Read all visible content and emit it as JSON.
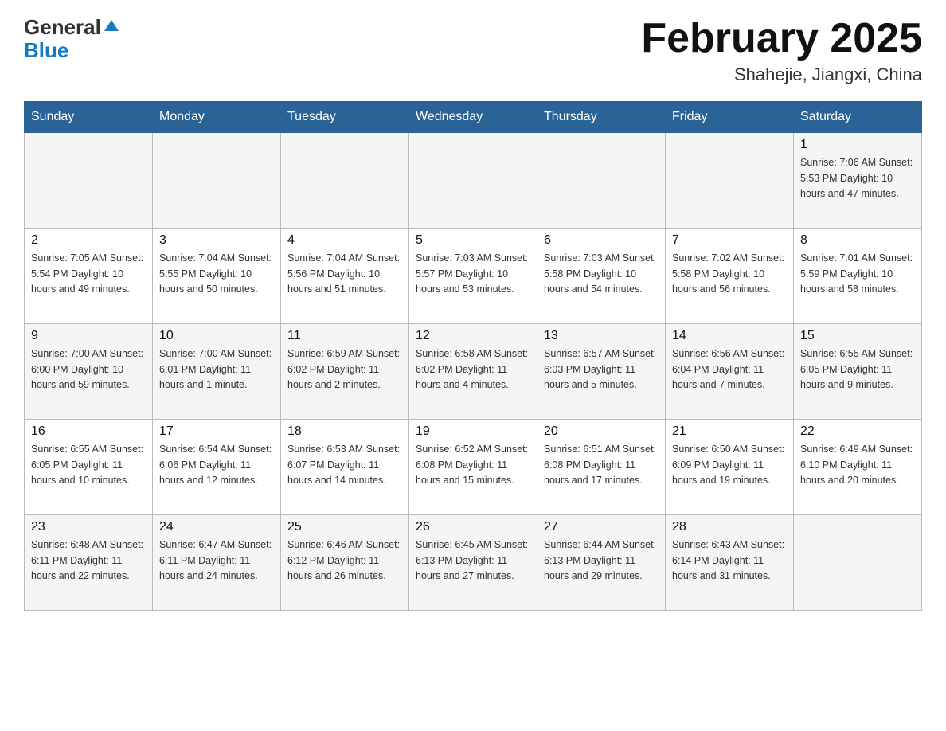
{
  "header": {
    "logo_general": "General",
    "logo_blue": "Blue",
    "title": "February 2025",
    "subtitle": "Shahejie, Jiangxi, China"
  },
  "days_of_week": [
    "Sunday",
    "Monday",
    "Tuesday",
    "Wednesday",
    "Thursday",
    "Friday",
    "Saturday"
  ],
  "weeks": [
    [
      {
        "day": "",
        "info": ""
      },
      {
        "day": "",
        "info": ""
      },
      {
        "day": "",
        "info": ""
      },
      {
        "day": "",
        "info": ""
      },
      {
        "day": "",
        "info": ""
      },
      {
        "day": "",
        "info": ""
      },
      {
        "day": "1",
        "info": "Sunrise: 7:06 AM\nSunset: 5:53 PM\nDaylight: 10 hours and 47 minutes."
      }
    ],
    [
      {
        "day": "2",
        "info": "Sunrise: 7:05 AM\nSunset: 5:54 PM\nDaylight: 10 hours and 49 minutes."
      },
      {
        "day": "3",
        "info": "Sunrise: 7:04 AM\nSunset: 5:55 PM\nDaylight: 10 hours and 50 minutes."
      },
      {
        "day": "4",
        "info": "Sunrise: 7:04 AM\nSunset: 5:56 PM\nDaylight: 10 hours and 51 minutes."
      },
      {
        "day": "5",
        "info": "Sunrise: 7:03 AM\nSunset: 5:57 PM\nDaylight: 10 hours and 53 minutes."
      },
      {
        "day": "6",
        "info": "Sunrise: 7:03 AM\nSunset: 5:58 PM\nDaylight: 10 hours and 54 minutes."
      },
      {
        "day": "7",
        "info": "Sunrise: 7:02 AM\nSunset: 5:58 PM\nDaylight: 10 hours and 56 minutes."
      },
      {
        "day": "8",
        "info": "Sunrise: 7:01 AM\nSunset: 5:59 PM\nDaylight: 10 hours and 58 minutes."
      }
    ],
    [
      {
        "day": "9",
        "info": "Sunrise: 7:00 AM\nSunset: 6:00 PM\nDaylight: 10 hours and 59 minutes."
      },
      {
        "day": "10",
        "info": "Sunrise: 7:00 AM\nSunset: 6:01 PM\nDaylight: 11 hours and 1 minute."
      },
      {
        "day": "11",
        "info": "Sunrise: 6:59 AM\nSunset: 6:02 PM\nDaylight: 11 hours and 2 minutes."
      },
      {
        "day": "12",
        "info": "Sunrise: 6:58 AM\nSunset: 6:02 PM\nDaylight: 11 hours and 4 minutes."
      },
      {
        "day": "13",
        "info": "Sunrise: 6:57 AM\nSunset: 6:03 PM\nDaylight: 11 hours and 5 minutes."
      },
      {
        "day": "14",
        "info": "Sunrise: 6:56 AM\nSunset: 6:04 PM\nDaylight: 11 hours and 7 minutes."
      },
      {
        "day": "15",
        "info": "Sunrise: 6:55 AM\nSunset: 6:05 PM\nDaylight: 11 hours and 9 minutes."
      }
    ],
    [
      {
        "day": "16",
        "info": "Sunrise: 6:55 AM\nSunset: 6:05 PM\nDaylight: 11 hours and 10 minutes."
      },
      {
        "day": "17",
        "info": "Sunrise: 6:54 AM\nSunset: 6:06 PM\nDaylight: 11 hours and 12 minutes."
      },
      {
        "day": "18",
        "info": "Sunrise: 6:53 AM\nSunset: 6:07 PM\nDaylight: 11 hours and 14 minutes."
      },
      {
        "day": "19",
        "info": "Sunrise: 6:52 AM\nSunset: 6:08 PM\nDaylight: 11 hours and 15 minutes."
      },
      {
        "day": "20",
        "info": "Sunrise: 6:51 AM\nSunset: 6:08 PM\nDaylight: 11 hours and 17 minutes."
      },
      {
        "day": "21",
        "info": "Sunrise: 6:50 AM\nSunset: 6:09 PM\nDaylight: 11 hours and 19 minutes."
      },
      {
        "day": "22",
        "info": "Sunrise: 6:49 AM\nSunset: 6:10 PM\nDaylight: 11 hours and 20 minutes."
      }
    ],
    [
      {
        "day": "23",
        "info": "Sunrise: 6:48 AM\nSunset: 6:11 PM\nDaylight: 11 hours and 22 minutes."
      },
      {
        "day": "24",
        "info": "Sunrise: 6:47 AM\nSunset: 6:11 PM\nDaylight: 11 hours and 24 minutes."
      },
      {
        "day": "25",
        "info": "Sunrise: 6:46 AM\nSunset: 6:12 PM\nDaylight: 11 hours and 26 minutes."
      },
      {
        "day": "26",
        "info": "Sunrise: 6:45 AM\nSunset: 6:13 PM\nDaylight: 11 hours and 27 minutes."
      },
      {
        "day": "27",
        "info": "Sunrise: 6:44 AM\nSunset: 6:13 PM\nDaylight: 11 hours and 29 minutes."
      },
      {
        "day": "28",
        "info": "Sunrise: 6:43 AM\nSunset: 6:14 PM\nDaylight: 11 hours and 31 minutes."
      },
      {
        "day": "",
        "info": ""
      }
    ]
  ]
}
